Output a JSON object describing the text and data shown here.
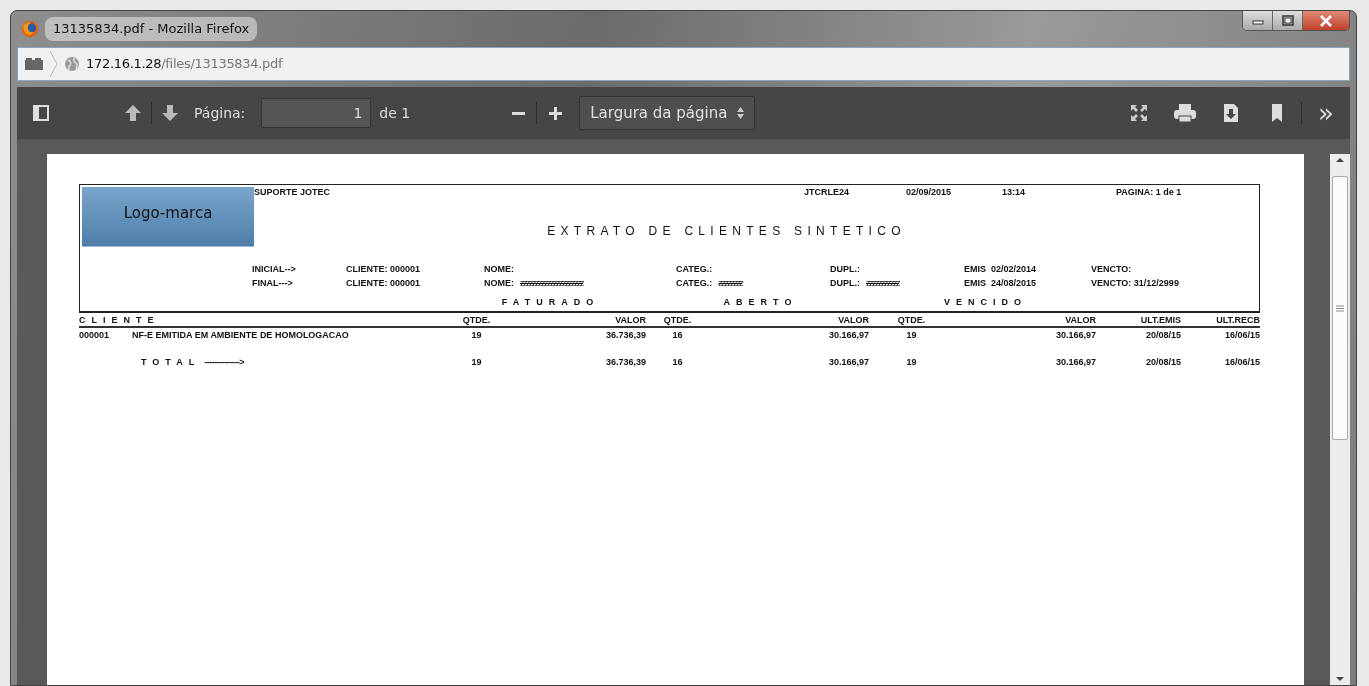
{
  "window": {
    "title": "13135834.pdf - Mozilla Firefox"
  },
  "address_bar": {
    "host": "172.16.1.28",
    "path": "/files/13135834.pdf"
  },
  "pdf_toolbar": {
    "page_label": "Página:",
    "page_value": "1",
    "page_count": "de 1",
    "zoom_select": "Largura da página",
    "more": "»"
  },
  "report": {
    "logo_text": "Logo-marca",
    "company": "SUPORTE JOTEC",
    "program": "JTCRLE24",
    "date": "02/09/2015",
    "time": "13:14",
    "page": "PAGINA: 1 de 1",
    "title": "EXTRATO DE CLIENTES SINTETICO",
    "filters": [
      [
        {
          "label": "INICIAL-->"
        },
        {
          "label": "CLIENTE: 000001"
        },
        {
          "label": "NOME:"
        },
        {
          "label": "CATEG.:"
        },
        {
          "label": "DUPL.:"
        },
        {
          "label": "EMIS  02/02/2014"
        },
        {
          "label": "VENCTO:"
        }
      ],
      [
        {
          "label": "FINAL--->"
        },
        {
          "label": "CLIENTE: 000001"
        },
        {
          "label": "NOME:",
          "masked": "zzzzzzzzzzzzzzzzzzzzz"
        },
        {
          "label": "CATEG.:",
          "masked": "zzzzzzzz"
        },
        {
          "label": "DUPL.:",
          "masked": "zzzzzzzzzzz"
        },
        {
          "label": "EMIS  24/08/2015"
        },
        {
          "label": "VENCTO: 31/12/2999"
        }
      ]
    ],
    "groups": [
      "FATURADO",
      "ABERTO",
      "VENCIDO"
    ],
    "columns": [
      "CLIENTE",
      "QTDE.",
      "VALOR",
      "QTDE.",
      "VALOR",
      "QTDE.",
      "VALOR",
      "ULT.EMIS",
      "ULT.RECB"
    ],
    "rows": [
      {
        "kind": "data",
        "cells": [
          {
            "code": "000001",
            "name": "NF-E EMITIDA EM AMBIENTE DE HOMOLOGACAO"
          },
          "19",
          "36.736,39",
          "16",
          "30.166,97",
          "19",
          "30.166,97",
          "20/08/15",
          "16/06/15"
        ]
      },
      {
        "kind": "total",
        "cells": [
          {
            "label": "TOTAL",
            "arrow": "-------------->"
          },
          "19",
          "36.736,39",
          "16",
          "30.166,97",
          "19",
          "30.166,97",
          "20/08/15",
          "16/06/15"
        ]
      }
    ]
  }
}
